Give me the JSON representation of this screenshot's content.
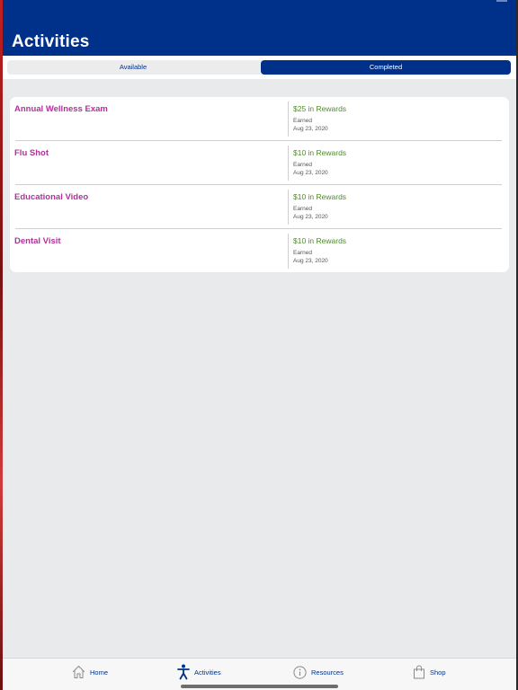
{
  "header": {
    "title": "Activities"
  },
  "segmented_control": {
    "options": [
      {
        "label": "Available",
        "selected": false
      },
      {
        "label": "Completed",
        "selected": true
      }
    ]
  },
  "activities": [
    {
      "title": "Annual Wellness Exam",
      "reward": "$25 in Rewards",
      "status": "Earned",
      "date": "Aug 23, 2020"
    },
    {
      "title": "Flu Shot",
      "reward": "$10 in Rewards",
      "status": "Earned",
      "date": "Aug 23, 2020"
    },
    {
      "title": "Educational Video",
      "reward": "$10 in Rewards",
      "status": "Earned",
      "date": "Aug 23, 2020"
    },
    {
      "title": "Dental Visit",
      "reward": "$10 in Rewards",
      "status": "Earned",
      "date": "Aug 23, 2020"
    }
  ],
  "tab_bar": {
    "items": [
      {
        "label": "Home",
        "icon": "home-icon",
        "active": false
      },
      {
        "label": "Activities",
        "icon": "person-activity-icon",
        "active": true
      },
      {
        "label": "Resources",
        "icon": "info-icon",
        "active": false
      },
      {
        "label": "Shop",
        "icon": "shopping-bag-icon",
        "active": false
      }
    ]
  },
  "colors": {
    "brand_blue": "#00318a",
    "activity_title": "#b4309c",
    "reward_green": "#4d8c2a",
    "background": "#e9eaec"
  }
}
